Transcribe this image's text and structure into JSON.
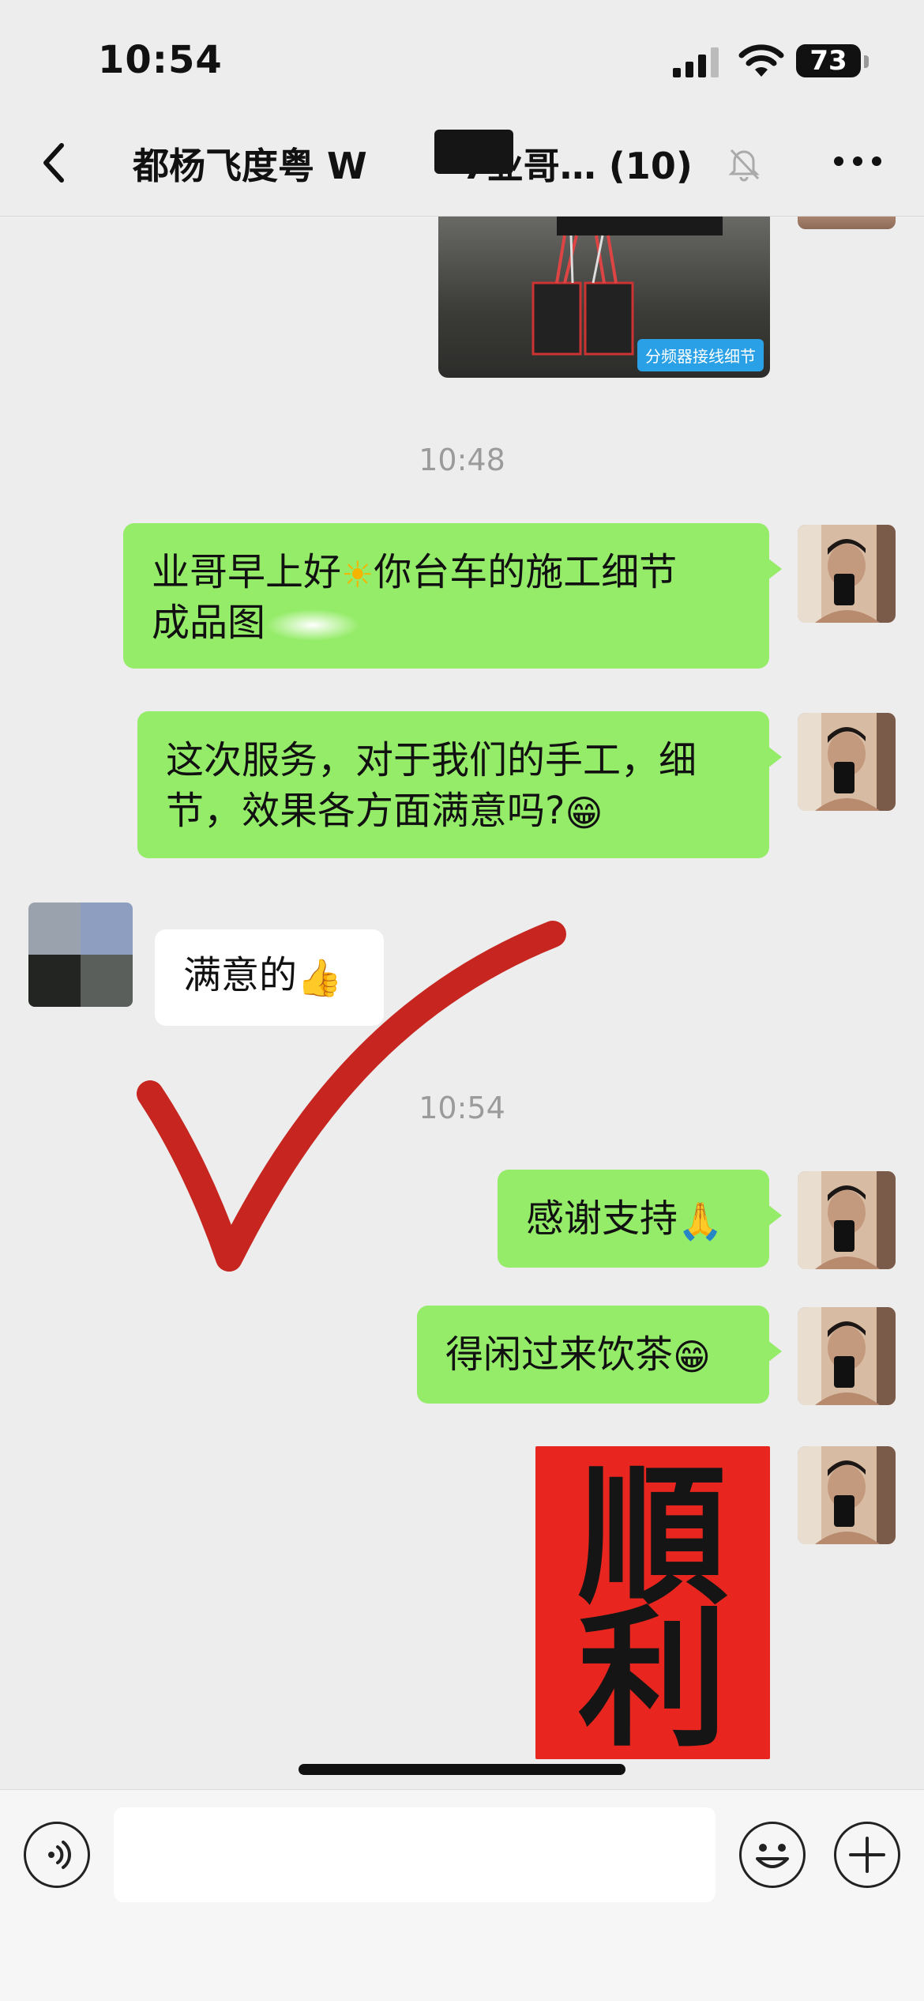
{
  "status_bar": {
    "time": "10:54",
    "battery": "73",
    "icons": [
      "signal-icon",
      "wifi-icon",
      "battery-icon"
    ]
  },
  "nav": {
    "title": "都杨飞度粤 W",
    "title_suffix": "7业哥… (10)",
    "icons": [
      "back-icon",
      "mute-icon",
      "more-icon"
    ]
  },
  "chat": {
    "photo_caption": "分频器接线细节",
    "separators": [
      "10:48",
      "10:54"
    ],
    "messages": [
      {
        "side": "right",
        "parts": [
          "业哥早上好",
          "你台车的施工细节",
          "成品图"
        ],
        "emoji": "☀"
      },
      {
        "side": "right",
        "text": "这次服务，对于我们的手工，细节，效果各方面满意吗?",
        "emoji": "😁"
      },
      {
        "side": "left",
        "text": "满意的",
        "emoji": "👍"
      },
      {
        "side": "right",
        "text": "感谢支持",
        "emoji": "🙏"
      },
      {
        "side": "right",
        "text": "得闲过来饮茶",
        "emoji": "😁"
      }
    ],
    "image_calligraphy": [
      "順",
      "利"
    ]
  },
  "input_bar": {
    "placeholder": "",
    "icons": [
      "voice-icon",
      "emoji-icon",
      "plus-icon"
    ]
  },
  "colors": {
    "self_bubble": "#95ec69",
    "other_bubble": "#ffffff",
    "background": "#ededed",
    "red_mark": "#c41a15"
  }
}
